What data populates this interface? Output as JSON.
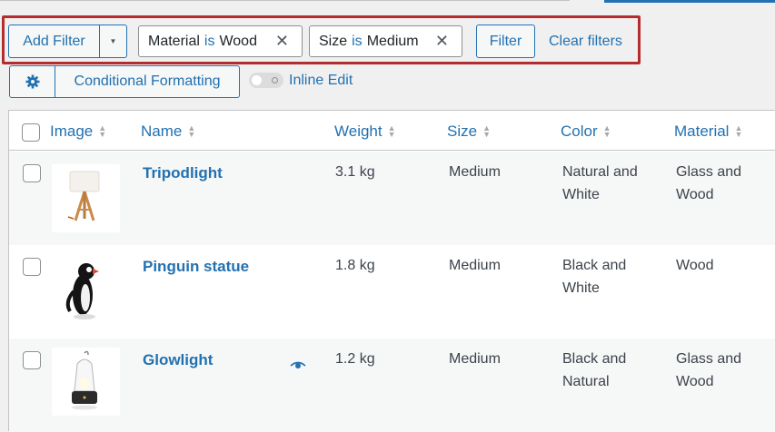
{
  "filters": {
    "add_filter_label": "Add Filter",
    "active": [
      {
        "field": "Material",
        "operator": "is",
        "value": "Wood"
      },
      {
        "field": "Size",
        "operator": "is",
        "value": "Medium"
      }
    ],
    "filter_label": "Filter",
    "clear_label": "Clear filters",
    "remove_glyph": "✕",
    "dropdown_glyph": "▼"
  },
  "toolbar": {
    "conditional_formatting_label": "Conditional Formatting",
    "inline_edit_label": "Inline Edit"
  },
  "table": {
    "columns": [
      "Image",
      "Name",
      "Weight",
      "Size",
      "Color",
      "Material"
    ],
    "rows": [
      {
        "name": "Tripodlight",
        "weight": "3.1 kg",
        "size": "Medium",
        "color_1": "Natural and",
        "color_2": "White",
        "material_1": "Glass and",
        "material_2": "Wood"
      },
      {
        "name": "Pinguin statue",
        "weight": "1.8 kg",
        "size": "Medium",
        "color_1": "Black and",
        "color_2": "White",
        "material_1": "Wood",
        "material_2": ""
      },
      {
        "name": "Glowlight",
        "weight": "1.2 kg",
        "size": "Medium",
        "color_1": "Black and",
        "color_2": "Natural",
        "material_1": "Glass and",
        "material_2": "Wood"
      }
    ]
  },
  "colors": {
    "accent": "#2271b1",
    "highlight": "#b32d2e"
  }
}
